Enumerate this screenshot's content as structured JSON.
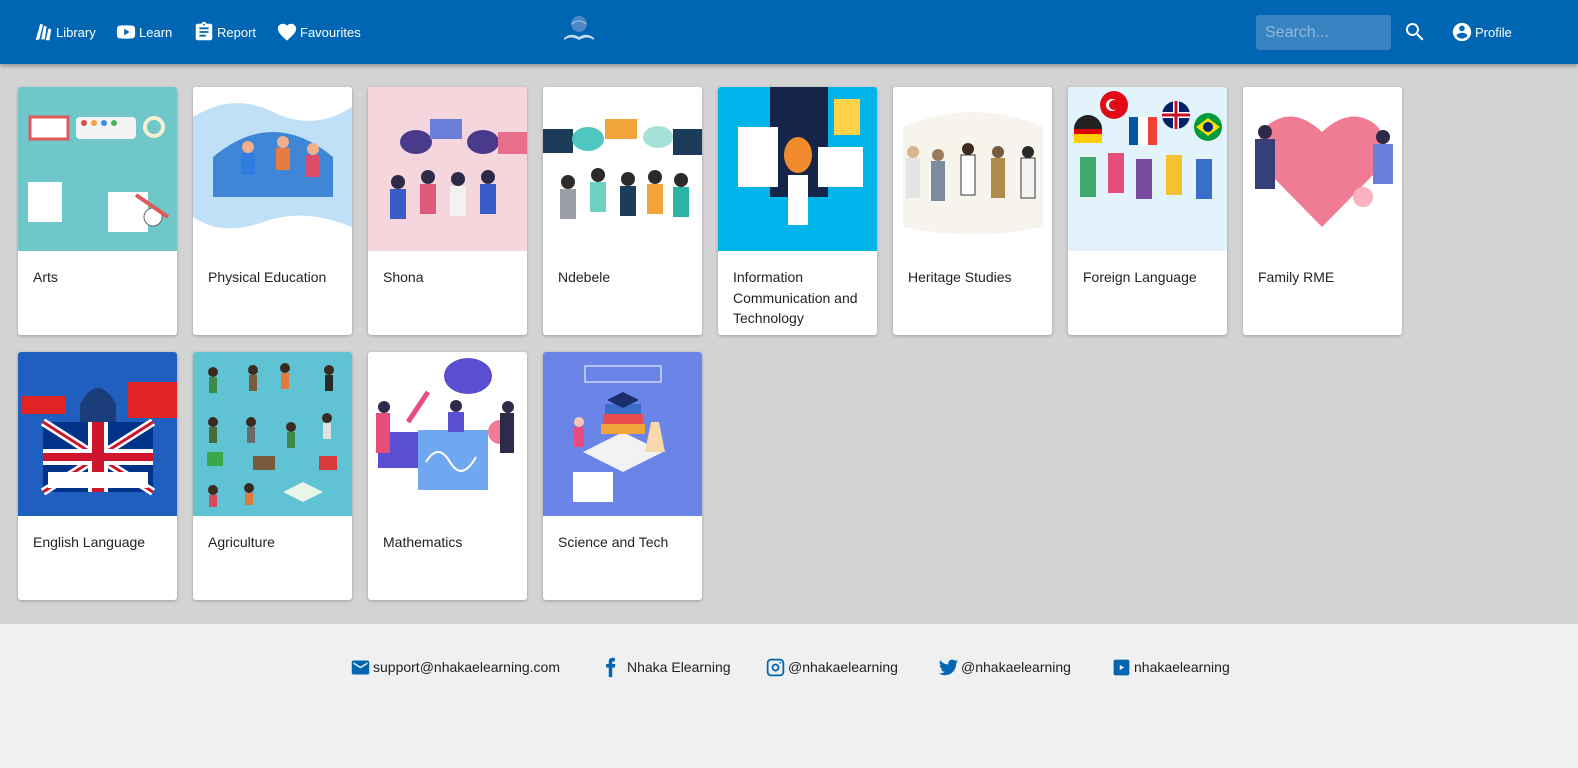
{
  "nav": {
    "library": "Library",
    "learn": "Learn",
    "report": "Report",
    "favourites": "Favourites",
    "profile": "Profile"
  },
  "search": {
    "placeholder": "Search..."
  },
  "subjects": [
    {
      "title": "Arts",
      "thumb_bg": "#6fc7c9"
    },
    {
      "title": "Physical Education",
      "thumb_bg": "#ffffff"
    },
    {
      "title": "Shona",
      "thumb_bg": "#f5d6dc"
    },
    {
      "title": "Ndebele",
      "thumb_bg": "#ffffff"
    },
    {
      "title": "Information Communication and Technology",
      "thumb_bg": "#00b3e8"
    },
    {
      "title": "Heritage Studies",
      "thumb_bg": "#ffffff"
    },
    {
      "title": "Foreign Language",
      "thumb_bg": "#e3f3fb"
    },
    {
      "title": "Family RME",
      "thumb_bg": "#ffffff"
    },
    {
      "title": "English Language",
      "thumb_bg": "#1e5fbf"
    },
    {
      "title": "Agriculture",
      "thumb_bg": "#5fc3d4"
    },
    {
      "title": "Mathematics",
      "thumb_bg": "#ffffff"
    },
    {
      "title": "Science and Tech",
      "thumb_bg": "#6b84e8"
    }
  ],
  "footer": {
    "email": "support@nhakaelearning.com",
    "facebook": "Nhaka Elearning",
    "instagram": "@nhakaelearning",
    "twitter": "@nhakaelearning",
    "youtube": "nhakaelearning"
  },
  "colors": {
    "header": "#0066b3",
    "content_bg": "#d3d3d3",
    "footer_bg": "#f0f0f0"
  }
}
